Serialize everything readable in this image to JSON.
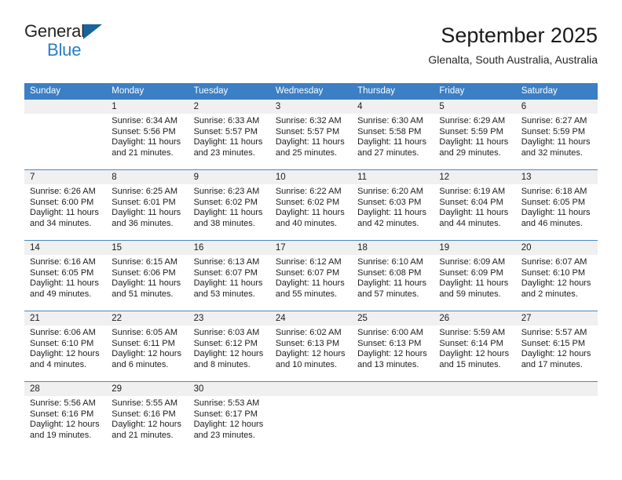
{
  "brand": {
    "line1": "General",
    "line2": "Blue",
    "triangle_icon": "triangle-icon"
  },
  "header": {
    "title": "September 2025",
    "subtitle": "Glenalta, South Australia, Australia"
  },
  "colors": {
    "header_blue": "#3b7fc4",
    "row_divider_blue": "#4a87c7",
    "daynum_band": "#f0f0f0",
    "brand_blue": "#2a7fc4",
    "triangle_blue": "#15659f"
  },
  "calendar": {
    "weekdays": [
      "Sunday",
      "Monday",
      "Tuesday",
      "Wednesday",
      "Thursday",
      "Friday",
      "Saturday"
    ],
    "weeks": [
      [
        {
          "day": "",
          "lines": []
        },
        {
          "day": "1",
          "lines": [
            "Sunrise: 6:34 AM",
            "Sunset: 5:56 PM",
            "Daylight: 11 hours",
            "and 21 minutes."
          ]
        },
        {
          "day": "2",
          "lines": [
            "Sunrise: 6:33 AM",
            "Sunset: 5:57 PM",
            "Daylight: 11 hours",
            "and 23 minutes."
          ]
        },
        {
          "day": "3",
          "lines": [
            "Sunrise: 6:32 AM",
            "Sunset: 5:57 PM",
            "Daylight: 11 hours",
            "and 25 minutes."
          ]
        },
        {
          "day": "4",
          "lines": [
            "Sunrise: 6:30 AM",
            "Sunset: 5:58 PM",
            "Daylight: 11 hours",
            "and 27 minutes."
          ]
        },
        {
          "day": "5",
          "lines": [
            "Sunrise: 6:29 AM",
            "Sunset: 5:59 PM",
            "Daylight: 11 hours",
            "and 29 minutes."
          ]
        },
        {
          "day": "6",
          "lines": [
            "Sunrise: 6:27 AM",
            "Sunset: 5:59 PM",
            "Daylight: 11 hours",
            "and 32 minutes."
          ]
        }
      ],
      [
        {
          "day": "7",
          "lines": [
            "Sunrise: 6:26 AM",
            "Sunset: 6:00 PM",
            "Daylight: 11 hours",
            "and 34 minutes."
          ]
        },
        {
          "day": "8",
          "lines": [
            "Sunrise: 6:25 AM",
            "Sunset: 6:01 PM",
            "Daylight: 11 hours",
            "and 36 minutes."
          ]
        },
        {
          "day": "9",
          "lines": [
            "Sunrise: 6:23 AM",
            "Sunset: 6:02 PM",
            "Daylight: 11 hours",
            "and 38 minutes."
          ]
        },
        {
          "day": "10",
          "lines": [
            "Sunrise: 6:22 AM",
            "Sunset: 6:02 PM",
            "Daylight: 11 hours",
            "and 40 minutes."
          ]
        },
        {
          "day": "11",
          "lines": [
            "Sunrise: 6:20 AM",
            "Sunset: 6:03 PM",
            "Daylight: 11 hours",
            "and 42 minutes."
          ]
        },
        {
          "day": "12",
          "lines": [
            "Sunrise: 6:19 AM",
            "Sunset: 6:04 PM",
            "Daylight: 11 hours",
            "and 44 minutes."
          ]
        },
        {
          "day": "13",
          "lines": [
            "Sunrise: 6:18 AM",
            "Sunset: 6:05 PM",
            "Daylight: 11 hours",
            "and 46 minutes."
          ]
        }
      ],
      [
        {
          "day": "14",
          "lines": [
            "Sunrise: 6:16 AM",
            "Sunset: 6:05 PM",
            "Daylight: 11 hours",
            "and 49 minutes."
          ]
        },
        {
          "day": "15",
          "lines": [
            "Sunrise: 6:15 AM",
            "Sunset: 6:06 PM",
            "Daylight: 11 hours",
            "and 51 minutes."
          ]
        },
        {
          "day": "16",
          "lines": [
            "Sunrise: 6:13 AM",
            "Sunset: 6:07 PM",
            "Daylight: 11 hours",
            "and 53 minutes."
          ]
        },
        {
          "day": "17",
          "lines": [
            "Sunrise: 6:12 AM",
            "Sunset: 6:07 PM",
            "Daylight: 11 hours",
            "and 55 minutes."
          ]
        },
        {
          "day": "18",
          "lines": [
            "Sunrise: 6:10 AM",
            "Sunset: 6:08 PM",
            "Daylight: 11 hours",
            "and 57 minutes."
          ]
        },
        {
          "day": "19",
          "lines": [
            "Sunrise: 6:09 AM",
            "Sunset: 6:09 PM",
            "Daylight: 11 hours",
            "and 59 minutes."
          ]
        },
        {
          "day": "20",
          "lines": [
            "Sunrise: 6:07 AM",
            "Sunset: 6:10 PM",
            "Daylight: 12 hours",
            "and 2 minutes."
          ]
        }
      ],
      [
        {
          "day": "21",
          "lines": [
            "Sunrise: 6:06 AM",
            "Sunset: 6:10 PM",
            "Daylight: 12 hours",
            "and 4 minutes."
          ]
        },
        {
          "day": "22",
          "lines": [
            "Sunrise: 6:05 AM",
            "Sunset: 6:11 PM",
            "Daylight: 12 hours",
            "and 6 minutes."
          ]
        },
        {
          "day": "23",
          "lines": [
            "Sunrise: 6:03 AM",
            "Sunset: 6:12 PM",
            "Daylight: 12 hours",
            "and 8 minutes."
          ]
        },
        {
          "day": "24",
          "lines": [
            "Sunrise: 6:02 AM",
            "Sunset: 6:13 PM",
            "Daylight: 12 hours",
            "and 10 minutes."
          ]
        },
        {
          "day": "25",
          "lines": [
            "Sunrise: 6:00 AM",
            "Sunset: 6:13 PM",
            "Daylight: 12 hours",
            "and 13 minutes."
          ]
        },
        {
          "day": "26",
          "lines": [
            "Sunrise: 5:59 AM",
            "Sunset: 6:14 PM",
            "Daylight: 12 hours",
            "and 15 minutes."
          ]
        },
        {
          "day": "27",
          "lines": [
            "Sunrise: 5:57 AM",
            "Sunset: 6:15 PM",
            "Daylight: 12 hours",
            "and 17 minutes."
          ]
        }
      ],
      [
        {
          "day": "28",
          "lines": [
            "Sunrise: 5:56 AM",
            "Sunset: 6:16 PM",
            "Daylight: 12 hours",
            "and 19 minutes."
          ]
        },
        {
          "day": "29",
          "lines": [
            "Sunrise: 5:55 AM",
            "Sunset: 6:16 PM",
            "Daylight: 12 hours",
            "and 21 minutes."
          ]
        },
        {
          "day": "30",
          "lines": [
            "Sunrise: 5:53 AM",
            "Sunset: 6:17 PM",
            "Daylight: 12 hours",
            "and 23 minutes."
          ]
        },
        {
          "day": "",
          "lines": []
        },
        {
          "day": "",
          "lines": []
        },
        {
          "day": "",
          "lines": []
        },
        {
          "day": "",
          "lines": []
        }
      ]
    ]
  }
}
